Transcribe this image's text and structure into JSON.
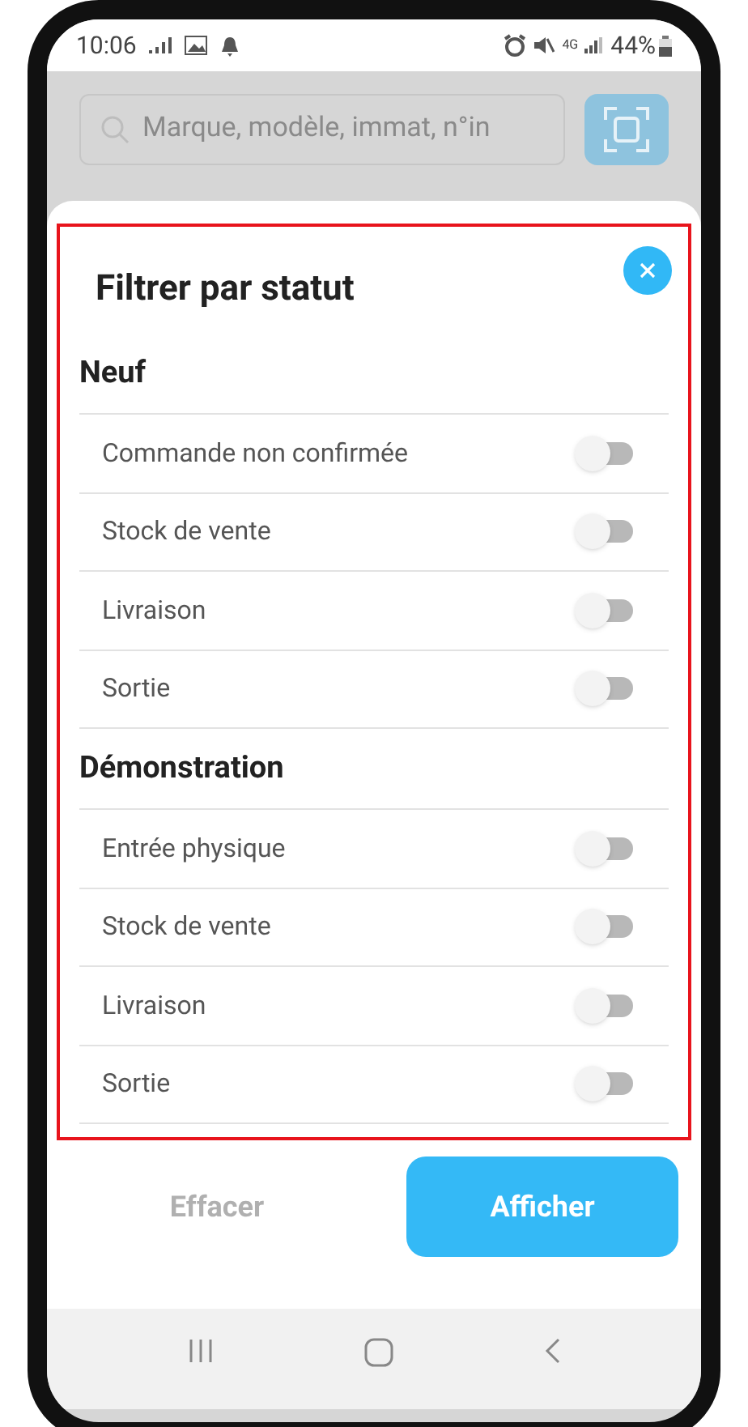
{
  "status_bar": {
    "time": "10:06",
    "network": "4G",
    "battery": "44%"
  },
  "search": {
    "placeholder": "Marque, modèle, immat, n°in"
  },
  "sheet": {
    "title": "Filtrer par statut",
    "sections": [
      {
        "title": "Neuf",
        "items": [
          {
            "label": "Commande non confirmée",
            "on": false
          },
          {
            "label": "Stock de vente",
            "on": false
          },
          {
            "label": "Livraison",
            "on": false
          },
          {
            "label": "Sortie",
            "on": false
          }
        ]
      },
      {
        "title": "Démonstration",
        "items": [
          {
            "label": "Entrée physique",
            "on": false
          },
          {
            "label": "Stock de vente",
            "on": false
          },
          {
            "label": "Livraison",
            "on": false
          },
          {
            "label": "Sortie",
            "on": false
          }
        ]
      }
    ],
    "buttons": [
      {
        "label": "Effacer",
        "kind": "text"
      },
      {
        "label": "Afficher",
        "kind": "primary"
      }
    ]
  }
}
